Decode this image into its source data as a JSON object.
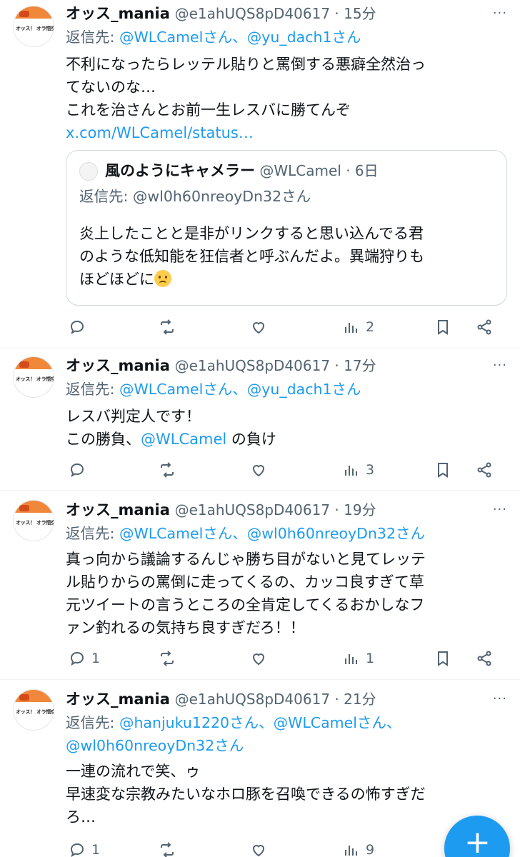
{
  "colors": {
    "accent": "#1d9bf0",
    "secondary_text": "#536471",
    "primary_text": "#0f1419",
    "avatar_band": "#f0873a"
  },
  "tweets": [
    {
      "avatar_text": "オッス！ オラ悟空！",
      "author": "オッス_mania",
      "handle": "@e1ahUQS8pD40617 · 15分",
      "reply_prefix": "返信先: ",
      "reply_mentions": "@WLCamelさん、@yu_dach1さん",
      "lines": [
        "不利になったらレッテル貼りと罵倒する悪癖全然治っ",
        "てないのな…",
        "これを治さんとお前一生レスバに勝てんぞ"
      ],
      "link": "x.com/WLCamel/status…",
      "quote": {
        "author": "風のようにキャメラー",
        "meta": " @WLCamel · 6日",
        "reply": "返信先: @wl0h60nreoyDn32さん",
        "lines": [
          "炎上したことと是非がリンクすると思い込んでる君",
          "のような低知能を狂信者と呼ぶんだよ。異端狩りも"
        ],
        "last_line": "ほどほどに"
      },
      "counts": {
        "replies": "",
        "retweets": "",
        "likes": "",
        "views": "2"
      }
    },
    {
      "avatar_text": "オッス！ オラ悟空！",
      "author": "オッス_mania",
      "handle": "@e1ahUQS8pD40617 · 17分",
      "reply_prefix": "返信先: ",
      "reply_mentions": "@WLCamelさん、@yu_dach1さん",
      "lines": [
        "レスバ判定人です！"
      ],
      "line2_prefix": "この勝負、",
      "line2_mention": "@WLCamel",
      "line2_suffix": " の負け",
      "counts": {
        "replies": "",
        "retweets": "",
        "likes": "",
        "views": "3"
      }
    },
    {
      "avatar_text": "オッス！ オラ悟空！",
      "author": "オッス_mania",
      "handle": "@e1ahUQS8pD40617 · 19分",
      "reply_prefix": "返信先: ",
      "reply_mentions": "@WLCamelさん、@wl0h60nreoyDn32さん",
      "lines": [
        "真っ向から議論するんじゃ勝ち目がないと見てレッテ",
        "ル貼りからの罵倒に走ってくるの、カッコ良すぎて草",
        "元ツイートの言うところの全肯定してくるおかしなフ",
        "ァン釣れるの気持ち良すぎだろ！！"
      ],
      "counts": {
        "replies": "1",
        "retweets": "",
        "likes": "",
        "views": "1"
      }
    },
    {
      "avatar_text": "オッス！ オラ悟空！",
      "author": "オッス_mania",
      "handle": "@e1ahUQS8pD40617 · 21分",
      "reply_prefix": "返信先: ",
      "reply_mentions": "@hanjuku1220さん、@WLCamelさん、",
      "reply_mentions_2": "@wl0h60nreoyDn32さん",
      "lines": [
        "一連の流れで笑、ゥ",
        "早速変な宗教みたいなホロ豚を召喚できるの怖すぎだ",
        "ろ…"
      ],
      "counts": {
        "replies": "1",
        "retweets": "",
        "likes": "",
        "views": "9"
      }
    }
  ],
  "fab_label": "+"
}
